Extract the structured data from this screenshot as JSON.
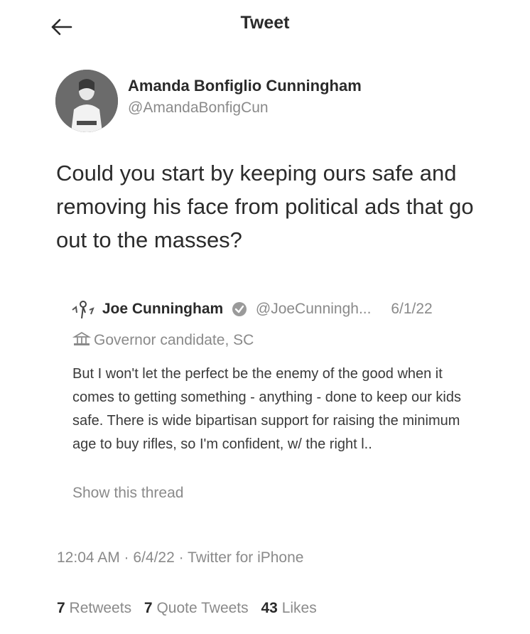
{
  "header": {
    "title": "Tweet",
    "back_icon": "arrow-left-icon"
  },
  "tweet": {
    "author_name": "Amanda Bonfiglio Cunningham",
    "author_handle": "@AmandaBonfigCun",
    "text": "Could you start by keeping ours safe and removing his face from political ads that go out to the masses?",
    "timestamp": "12:04 AM · 6/4/22 · Twitter for iPhone"
  },
  "quoted_tweet": {
    "author_name": "Joe Cunningham",
    "author_handle": "@JoeCunningh...",
    "date": "6/1/22",
    "label": "Governor candidate, SC",
    "text": "But I won't let the perfect be the enemy of the good when it comes to getting something - anything - done to keep our kids safe. There is wide bipartisan support for raising the minimum age to buy rifles, so I'm confident, w/ the right l..",
    "show_thread": "Show this thread"
  },
  "stats": {
    "retweets_count": "7",
    "retweets_label": "Retweets",
    "quotes_count": "7",
    "quotes_label": "Quote Tweets",
    "likes_count": "43",
    "likes_label": "Likes"
  },
  "colors": {
    "text": "#2a2a2a",
    "secondary": "#8a8a8a",
    "background": "#ffffff"
  }
}
